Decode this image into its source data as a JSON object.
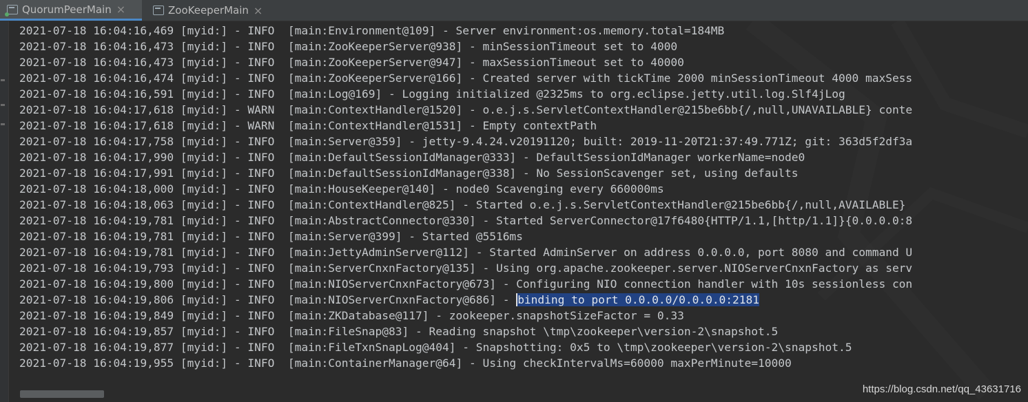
{
  "tabs": [
    {
      "label": "QuorumPeerMain",
      "active": true
    },
    {
      "label": "ZooKeeperMain",
      "active": false
    }
  ],
  "console": {
    "lines": [
      "2021-07-18 16:04:16,469 [myid:] - INFO  [main:Environment@109] - Server environment:os.memory.total=184MB",
      "2021-07-18 16:04:16,473 [myid:] - INFO  [main:ZooKeeperServer@938] - minSessionTimeout set to 4000",
      "2021-07-18 16:04:16,473 [myid:] - INFO  [main:ZooKeeperServer@947] - maxSessionTimeout set to 40000",
      "2021-07-18 16:04:16,474 [myid:] - INFO  [main:ZooKeeperServer@166] - Created server with tickTime 2000 minSessionTimeout 4000 maxSess",
      "2021-07-18 16:04:16,591 [myid:] - INFO  [main:Log@169] - Logging initialized @2325ms to org.eclipse.jetty.util.log.Slf4jLog",
      "2021-07-18 16:04:17,618 [myid:] - WARN  [main:ContextHandler@1520] - o.e.j.s.ServletContextHandler@215be6bb{/,null,UNAVAILABLE} conte",
      "2021-07-18 16:04:17,618 [myid:] - WARN  [main:ContextHandler@1531] - Empty contextPath",
      "2021-07-18 16:04:17,758 [myid:] - INFO  [main:Server@359] - jetty-9.4.24.v20191120; built: 2019-11-20T21:37:49.771Z; git: 363d5f2df3a",
      "2021-07-18 16:04:17,990 [myid:] - INFO  [main:DefaultSessionIdManager@333] - DefaultSessionIdManager workerName=node0",
      "2021-07-18 16:04:17,991 [myid:] - INFO  [main:DefaultSessionIdManager@338] - No SessionScavenger set, using defaults",
      "2021-07-18 16:04:18,000 [myid:] - INFO  [main:HouseKeeper@140] - node0 Scavenging every 660000ms",
      "2021-07-18 16:04:18,063 [myid:] - INFO  [main:ContextHandler@825] - Started o.e.j.s.ServletContextHandler@215be6bb{/,null,AVAILABLE}",
      "2021-07-18 16:04:19,781 [myid:] - INFO  [main:AbstractConnector@330] - Started ServerConnector@17f6480{HTTP/1.1,[http/1.1]}{0.0.0.0:8",
      "2021-07-18 16:04:19,781 [myid:] - INFO  [main:Server@399] - Started @5516ms",
      "2021-07-18 16:04:19,781 [myid:] - INFO  [main:JettyAdminServer@112] - Started AdminServer on address 0.0.0.0, port 8080 and command U",
      "2021-07-18 16:04:19,793 [myid:] - INFO  [main:ServerCnxnFactory@135] - Using org.apache.zookeeper.server.NIOServerCnxnFactory as serv",
      "2021-07-18 16:04:19,800 [myid:] - INFO  [main:NIOServerCnxnFactory@673] - Configuring NIO connection handler with 10s sessionless con",
      "2021-07-18 16:04:19,849 [myid:] - INFO  [main:ZKDatabase@117] - zookeeper.snapshotSizeFactor = 0.33",
      "2021-07-18 16:04:19,857 [myid:] - INFO  [main:FileSnap@83] - Reading snapshot \\tmp\\zookeeper\\version-2\\snapshot.5",
      "2021-07-18 16:04:19,877 [myid:] - INFO  [main:FileTxnSnapLog@404] - Snapshotting: 0x5 to \\tmp\\zookeeper\\version-2\\snapshot.5",
      "2021-07-18 16:04:19,955 [myid:] - INFO  [main:ContainerManager@64] - Using checkIntervalMs=60000 maxPerMinute=10000"
    ],
    "highlighted_line": {
      "prefix": "2021-07-18 16:04:19,806 [myid:] - INFO  [main:NIOServerCnxnFactory@686] - ",
      "selected": "binding to port 0.0.0.0/0.0.0.0:2181"
    }
  },
  "watermark": "https://blog.csdn.net/qq_43631716",
  "colors": {
    "background": "#2b2b2b",
    "text": "#c4c7ca",
    "selection": "#214283",
    "tab_active_underline": "#4a88c7"
  },
  "icons": {
    "tab_icon": "console-run-icon",
    "tab_close": "close-icon"
  }
}
